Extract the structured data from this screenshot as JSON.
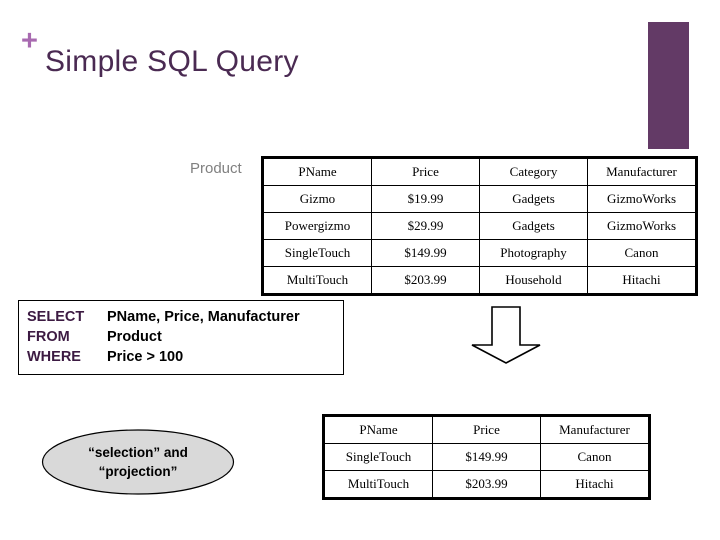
{
  "slide": {
    "title": "Simple SQL Query",
    "bullet_glyph": "+",
    "accent_color": "#633a66",
    "title_color": "#4a2a52",
    "bullet_color": "#a86ab0"
  },
  "relation": {
    "label": "Product"
  },
  "product_table": {
    "headers": [
      "PName",
      "Price",
      "Category",
      "Manufacturer"
    ],
    "rows": [
      [
        "Gizmo",
        "$19.99",
        "Gadgets",
        "GizmoWorks"
      ],
      [
        "Powergizmo",
        "$29.99",
        "Gadgets",
        "GizmoWorks"
      ],
      [
        "SingleTouch",
        "$149.99",
        "Photography",
        "Canon"
      ],
      [
        "MultiTouch",
        "$203.99",
        "Household",
        "Hitachi"
      ]
    ]
  },
  "sql": {
    "lines": [
      {
        "keyword": "SELECT",
        "rest": "PName, Price, Manufacturer"
      },
      {
        "keyword": "FROM",
        "rest": "Product"
      },
      {
        "keyword": "WHERE",
        "rest": "Price > 100"
      }
    ]
  },
  "arrow": {
    "direction": "down"
  },
  "callout": {
    "line1": "“selection” and",
    "line2": "“projection”",
    "fill": "#d9d9d9",
    "stroke": "#000000"
  },
  "result_table": {
    "headers": [
      "PName",
      "Price",
      "Manufacturer"
    ],
    "rows": [
      [
        "SingleTouch",
        "$149.99",
        "Canon"
      ],
      [
        "MultiTouch",
        "$203.99",
        "Hitachi"
      ]
    ]
  }
}
